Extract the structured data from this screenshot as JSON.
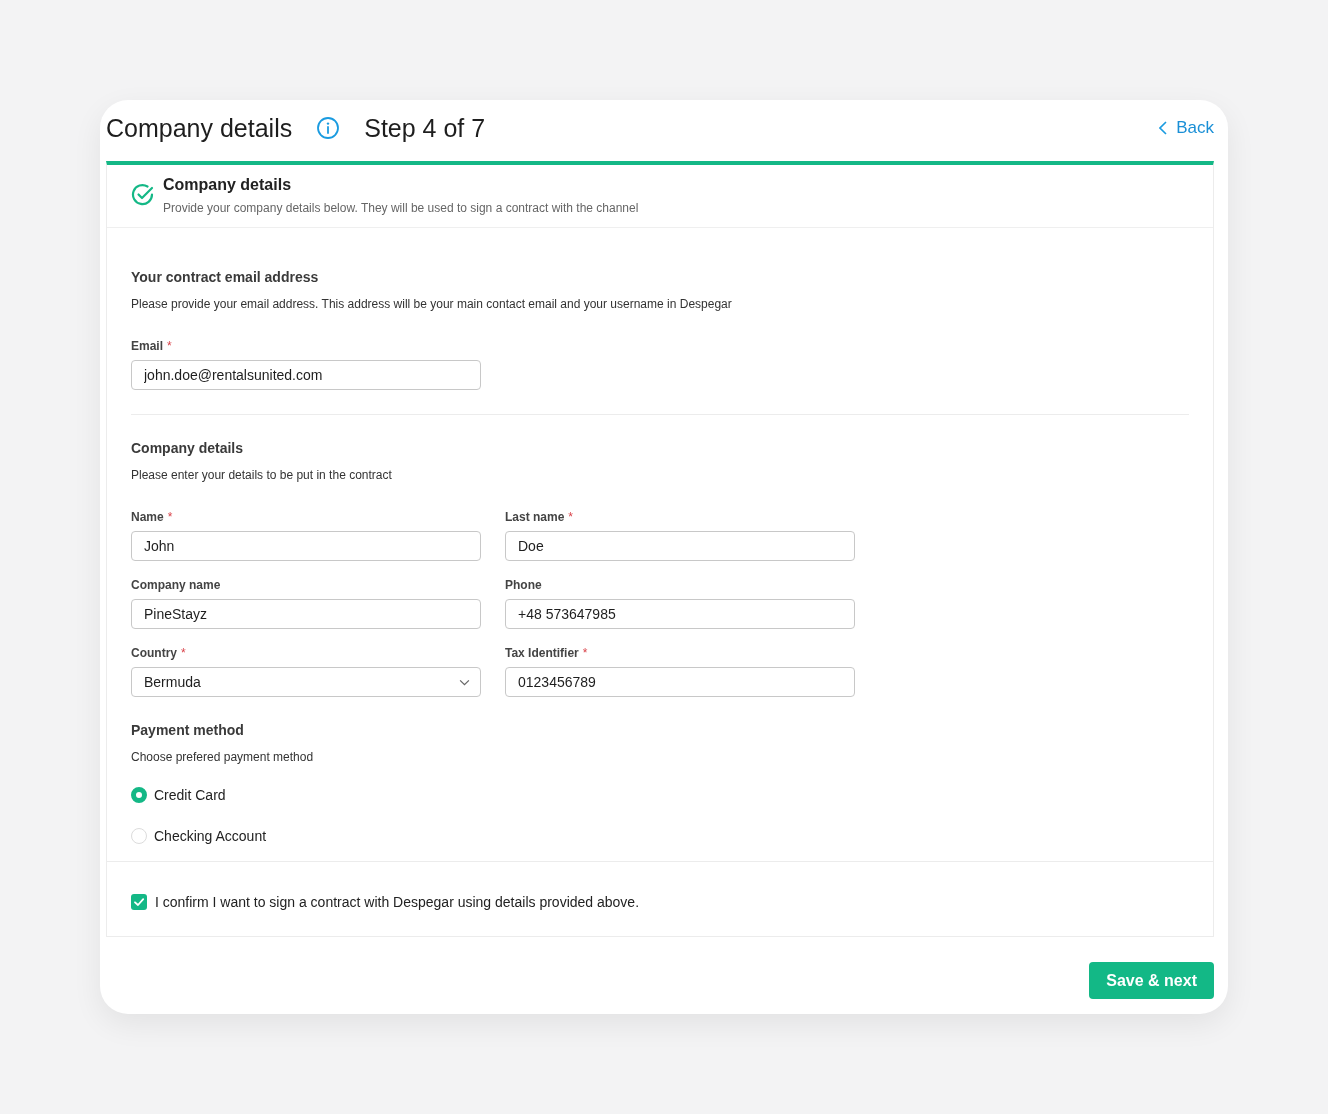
{
  "header": {
    "title": "Company details",
    "step": "Step 4 of 7",
    "back": "Back"
  },
  "panel": {
    "title": "Company details",
    "subtitle": "Provide your company details below. They will be used to sign a contract with the channel"
  },
  "sections": [
    {
      "title": "Your contract email address",
      "description": "Please provide your email address. This address will be your main contact email and your username in Despegar",
      "fields": [
        {
          "label": "Email",
          "required_mark": "*",
          "kind": "text",
          "value": "john.doe@rentalsunited.com"
        }
      ]
    },
    {
      "title": "Company details",
      "description": "Please enter your details to be put in the contract",
      "fields": [
        {
          "label": "Name",
          "required_mark": "*",
          "kind": "text",
          "value": "John"
        },
        {
          "label": "Last name",
          "required_mark": "*",
          "kind": "text",
          "value": "Doe"
        },
        {
          "label": "Company name",
          "kind": "text",
          "value": "PineStayz"
        },
        {
          "label": "Phone",
          "kind": "text",
          "value": "+48 573647985"
        },
        {
          "label": "Country",
          "required_mark": "*",
          "kind": "select",
          "value": "Bermuda"
        },
        {
          "label": "Tax Identifier",
          "required_mark": "*",
          "kind": "text",
          "value": "0123456789"
        }
      ]
    }
  ],
  "payment": {
    "title": "Payment method",
    "description": "Choose prefered payment method",
    "options": [
      {
        "label": "Credit Card",
        "selected": true
      },
      {
        "label": "Checking Account",
        "selected": false
      }
    ]
  },
  "confirm": {
    "label": "I confirm I want to sign a contract with Despegar using details provided above.",
    "checked": true
  },
  "submit": {
    "label": "Save & next"
  }
}
